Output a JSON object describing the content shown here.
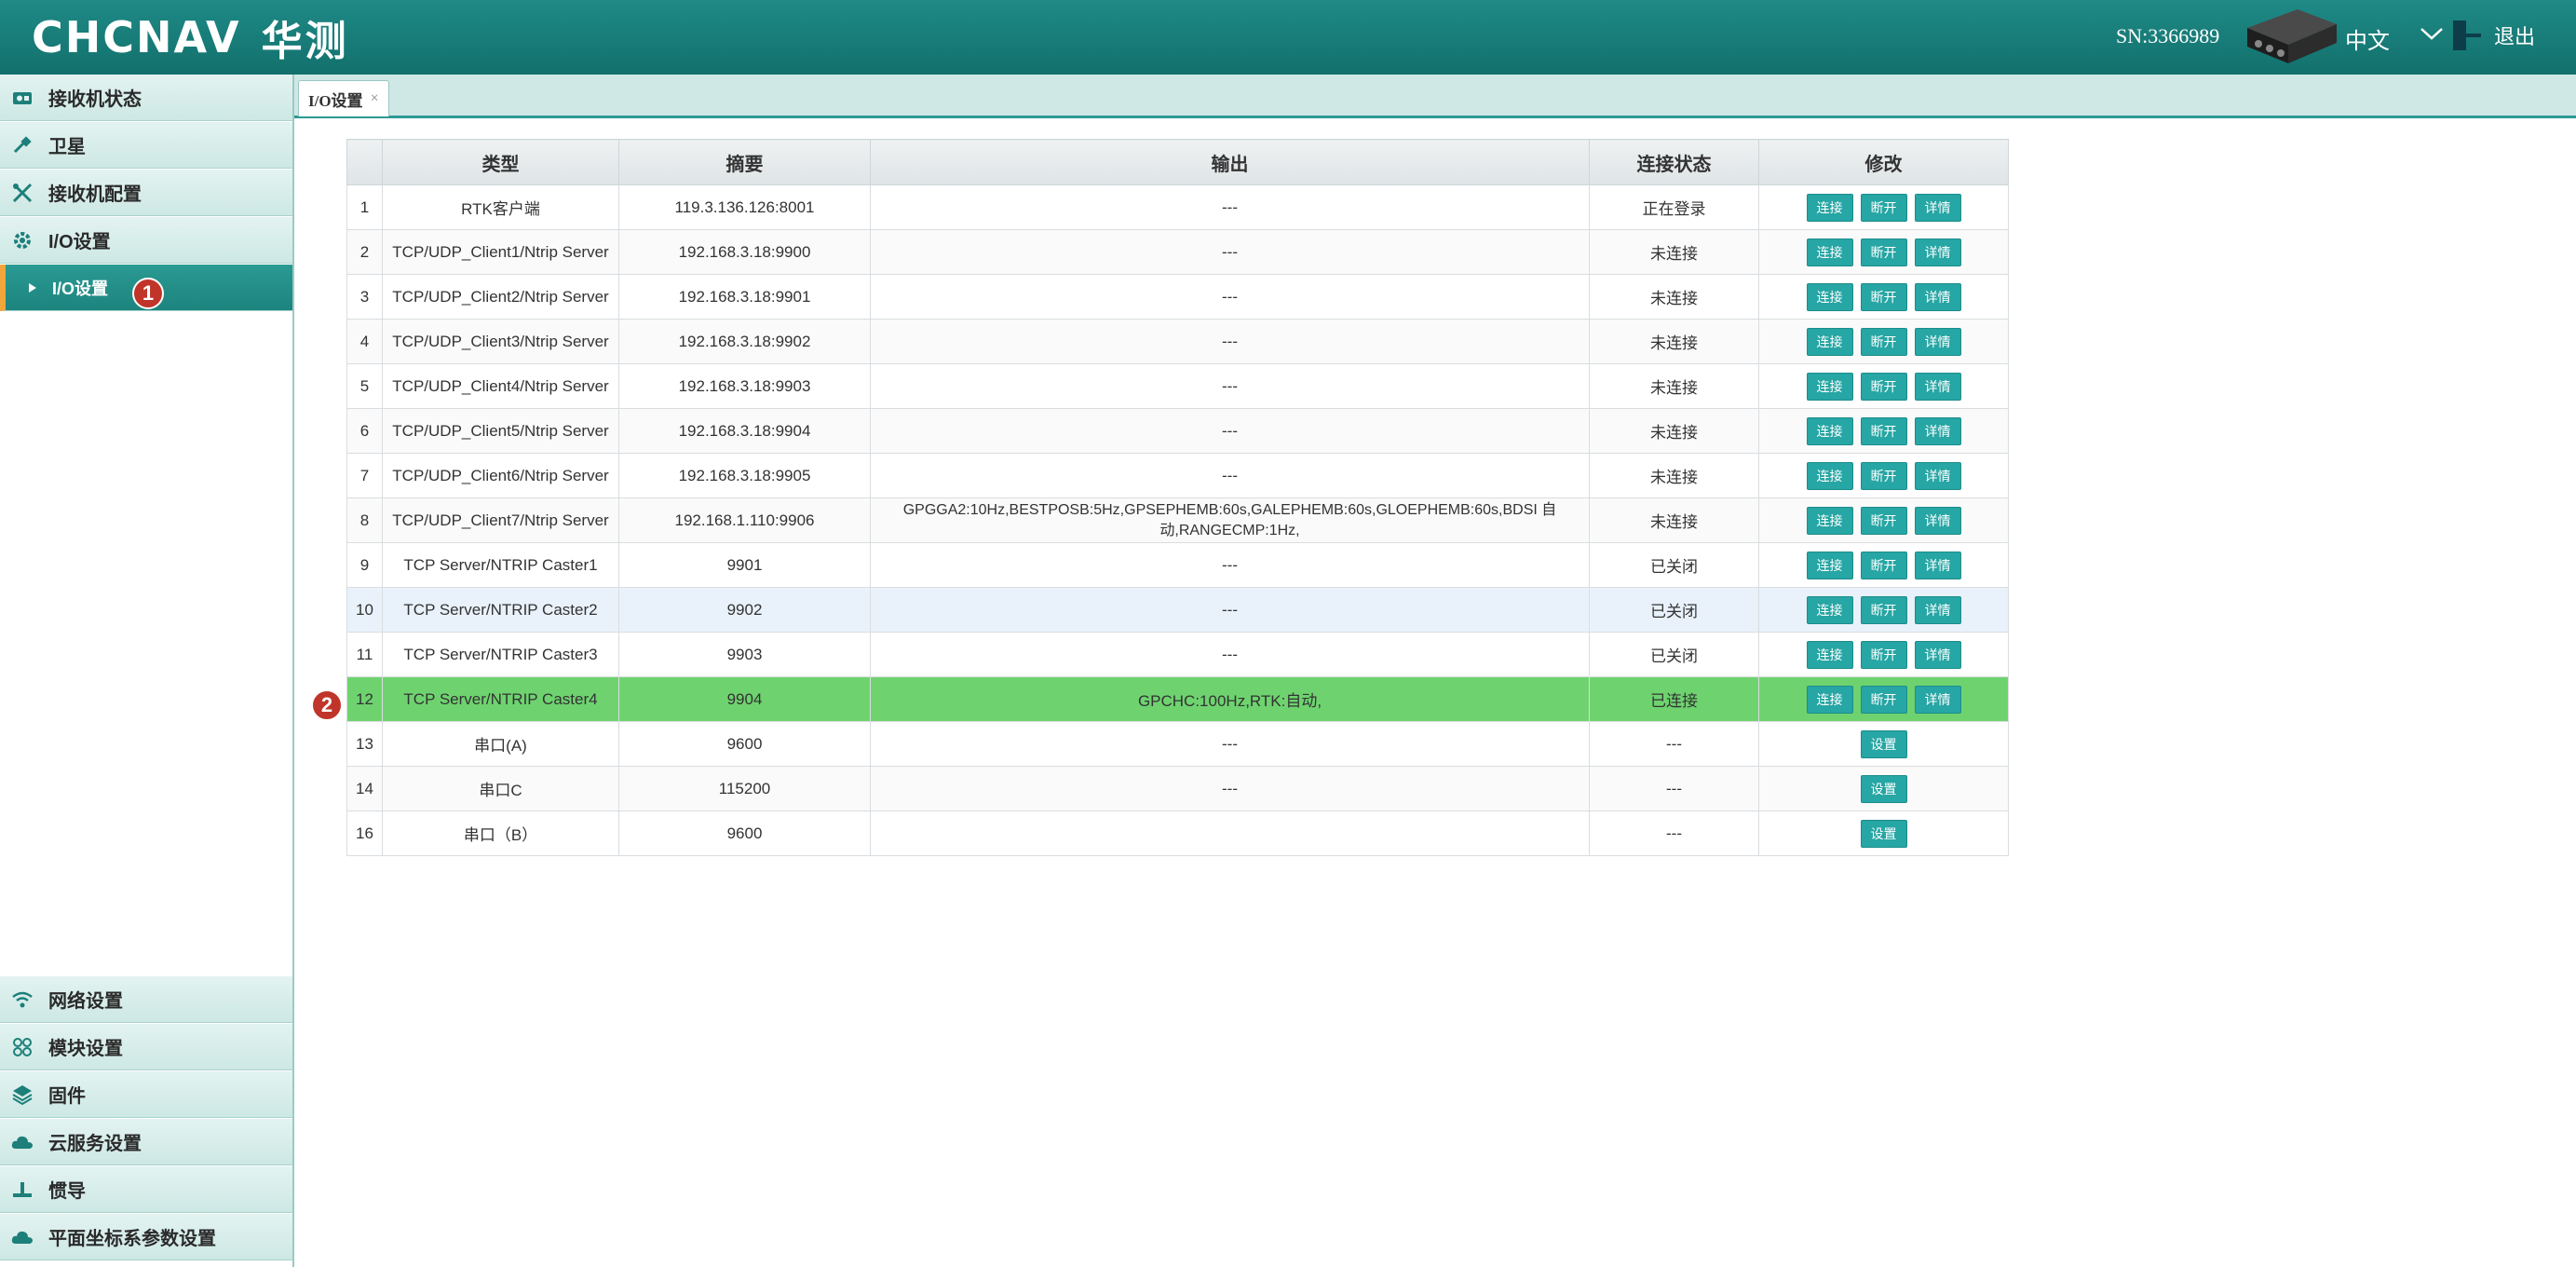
{
  "header": {
    "brand": "CHCNAV",
    "brand_cn": "华测",
    "sn": "SN:3366989",
    "lang": "中文",
    "logout": "退出"
  },
  "tab": {
    "label": "I/O设置",
    "close": "×"
  },
  "sidebar": {
    "top_items": [
      {
        "label": "接收机状态",
        "icon": "receiver-icon"
      },
      {
        "label": "卫星",
        "icon": "satellite-icon"
      },
      {
        "label": "接收机配置",
        "icon": "tools-icon"
      },
      {
        "label": "I/O设置",
        "icon": "gear-icon"
      }
    ],
    "active_sub": {
      "label": "I/O设置",
      "badge": "1"
    },
    "bottom_items": [
      {
        "label": "网络设置",
        "icon": "wifi-icon"
      },
      {
        "label": "模块设置",
        "icon": "modules-icon"
      },
      {
        "label": "固件",
        "icon": "layers-icon"
      },
      {
        "label": "云服务设置",
        "icon": "cloud-icon"
      },
      {
        "label": "惯导",
        "icon": "antenna-icon"
      },
      {
        "label": "平面坐标系参数设置",
        "icon": "cloud-icon"
      }
    ]
  },
  "table": {
    "headers": [
      "类型",
      "摘要",
      "输出",
      "连接状态",
      "修改"
    ],
    "buttons": {
      "connect": "连接",
      "disconnect": "断开",
      "detail": "详情",
      "settings": "设置"
    },
    "rows": [
      {
        "no": "1",
        "type": "RTK客户端",
        "summary": "119.3.136.126:8001",
        "output": "---",
        "status": "正在登录",
        "kind": "net"
      },
      {
        "no": "2",
        "type": "TCP/UDP_Client1/Ntrip Server",
        "summary": "192.168.3.18:9900",
        "output": "---",
        "status": "未连接",
        "kind": "net"
      },
      {
        "no": "3",
        "type": "TCP/UDP_Client2/Ntrip Server",
        "summary": "192.168.3.18:9901",
        "output": "---",
        "status": "未连接",
        "kind": "net"
      },
      {
        "no": "4",
        "type": "TCP/UDP_Client3/Ntrip Server",
        "summary": "192.168.3.18:9902",
        "output": "---",
        "status": "未连接",
        "kind": "net"
      },
      {
        "no": "5",
        "type": "TCP/UDP_Client4/Ntrip Server",
        "summary": "192.168.3.18:9903",
        "output": "---",
        "status": "未连接",
        "kind": "net"
      },
      {
        "no": "6",
        "type": "TCP/UDP_Client5/Ntrip Server",
        "summary": "192.168.3.18:9904",
        "output": "---",
        "status": "未连接",
        "kind": "net"
      },
      {
        "no": "7",
        "type": "TCP/UDP_Client6/Ntrip Server",
        "summary": "192.168.3.18:9905",
        "output": "---",
        "status": "未连接",
        "kind": "net"
      },
      {
        "no": "8",
        "type": "TCP/UDP_Client7/Ntrip Server",
        "summary": "192.168.1.110:9906",
        "output": "GPGGA2:10Hz,BESTPOSB:5Hz,GPSEPHEMB:60s,GALEPHEMB:60s,GLOEPHEMB:60s,BDSI 自动,RANGECMP:1Hz,",
        "status": "未连接",
        "kind": "net"
      },
      {
        "no": "9",
        "type": "TCP Server/NTRIP Caster1",
        "summary": "9901",
        "output": "---",
        "status": "已关闭",
        "kind": "net"
      },
      {
        "no": "10",
        "type": "TCP Server/NTRIP Caster2",
        "summary": "9902",
        "output": "---",
        "status": "已关闭",
        "kind": "net"
      },
      {
        "no": "11",
        "type": "TCP Server/NTRIP Caster3",
        "summary": "9903",
        "output": "---",
        "status": "已关闭",
        "kind": "net"
      },
      {
        "no": "12",
        "type": "TCP Server/NTRIP Caster4",
        "summary": "9904",
        "output": "GPCHC:100Hz,RTK:自动,",
        "status": "已连接",
        "kind": "net"
      },
      {
        "no": "13",
        "type": "串口(A)",
        "summary": "9600",
        "output": "---",
        "status": "---",
        "kind": "serial"
      },
      {
        "no": "14",
        "type": "串口C",
        "summary": "115200",
        "output": "---",
        "status": "---",
        "kind": "serial"
      },
      {
        "no": "16",
        "type": "串口（B）",
        "summary": "9600",
        "output": "",
        "status": "---",
        "kind": "serial"
      }
    ],
    "selected_row": "12",
    "selected_badge": "2",
    "highlight_color": "#6ed36f"
  },
  "colors": {
    "header": "#1a7f7b",
    "accent": "#26a6a4",
    "selected": "#6ed36f",
    "badge": "#c0342a"
  }
}
